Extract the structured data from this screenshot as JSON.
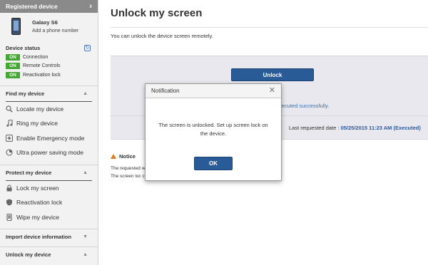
{
  "sidebar": {
    "registered_label": "Registered device",
    "device_name": "Galaxy S6",
    "add_phone": "Add a phone number",
    "status_title": "Device status",
    "status": [
      {
        "badge": "ON",
        "label": "Connection"
      },
      {
        "badge": "ON",
        "label": "Remote Controls"
      },
      {
        "badge": "ON",
        "label": "Reactivation lock"
      }
    ],
    "sections": {
      "find": {
        "title": "Find my device",
        "items": [
          "Locate my device",
          "Ring my device",
          "Enable Emergency mode",
          "Ultra power saving mode"
        ]
      },
      "protect": {
        "title": "Protect my device",
        "items": [
          "Lock my screen",
          "Reactivation lock",
          "Wipe my device"
        ]
      },
      "import": {
        "title": "Import device information"
      },
      "unlock": {
        "title": "Unlock my device"
      }
    }
  },
  "main": {
    "title": "Unlock my screen",
    "description": "You can unlock the device screen remotely.",
    "unlock_button": "Unlock",
    "executed_text": "xecuted successfully.",
    "last_requested_label": "Last requested date :",
    "last_requested_value": "05/25/2015 11:23 AM (Executed)",
    "notice_title": "Notice",
    "notice_lines": [
      "The requested                                                                                        work environment and the device state.",
      "The screen loc                                                                                       ction will be released."
    ]
  },
  "modal": {
    "title": "Notification",
    "message": "The screen is unlocked. Set up screen lock on the device.",
    "ok": "OK"
  },
  "colors": {
    "accent": "#295b97",
    "on_badge": "#44a633",
    "sidebar_header": "#8a8a8a"
  }
}
